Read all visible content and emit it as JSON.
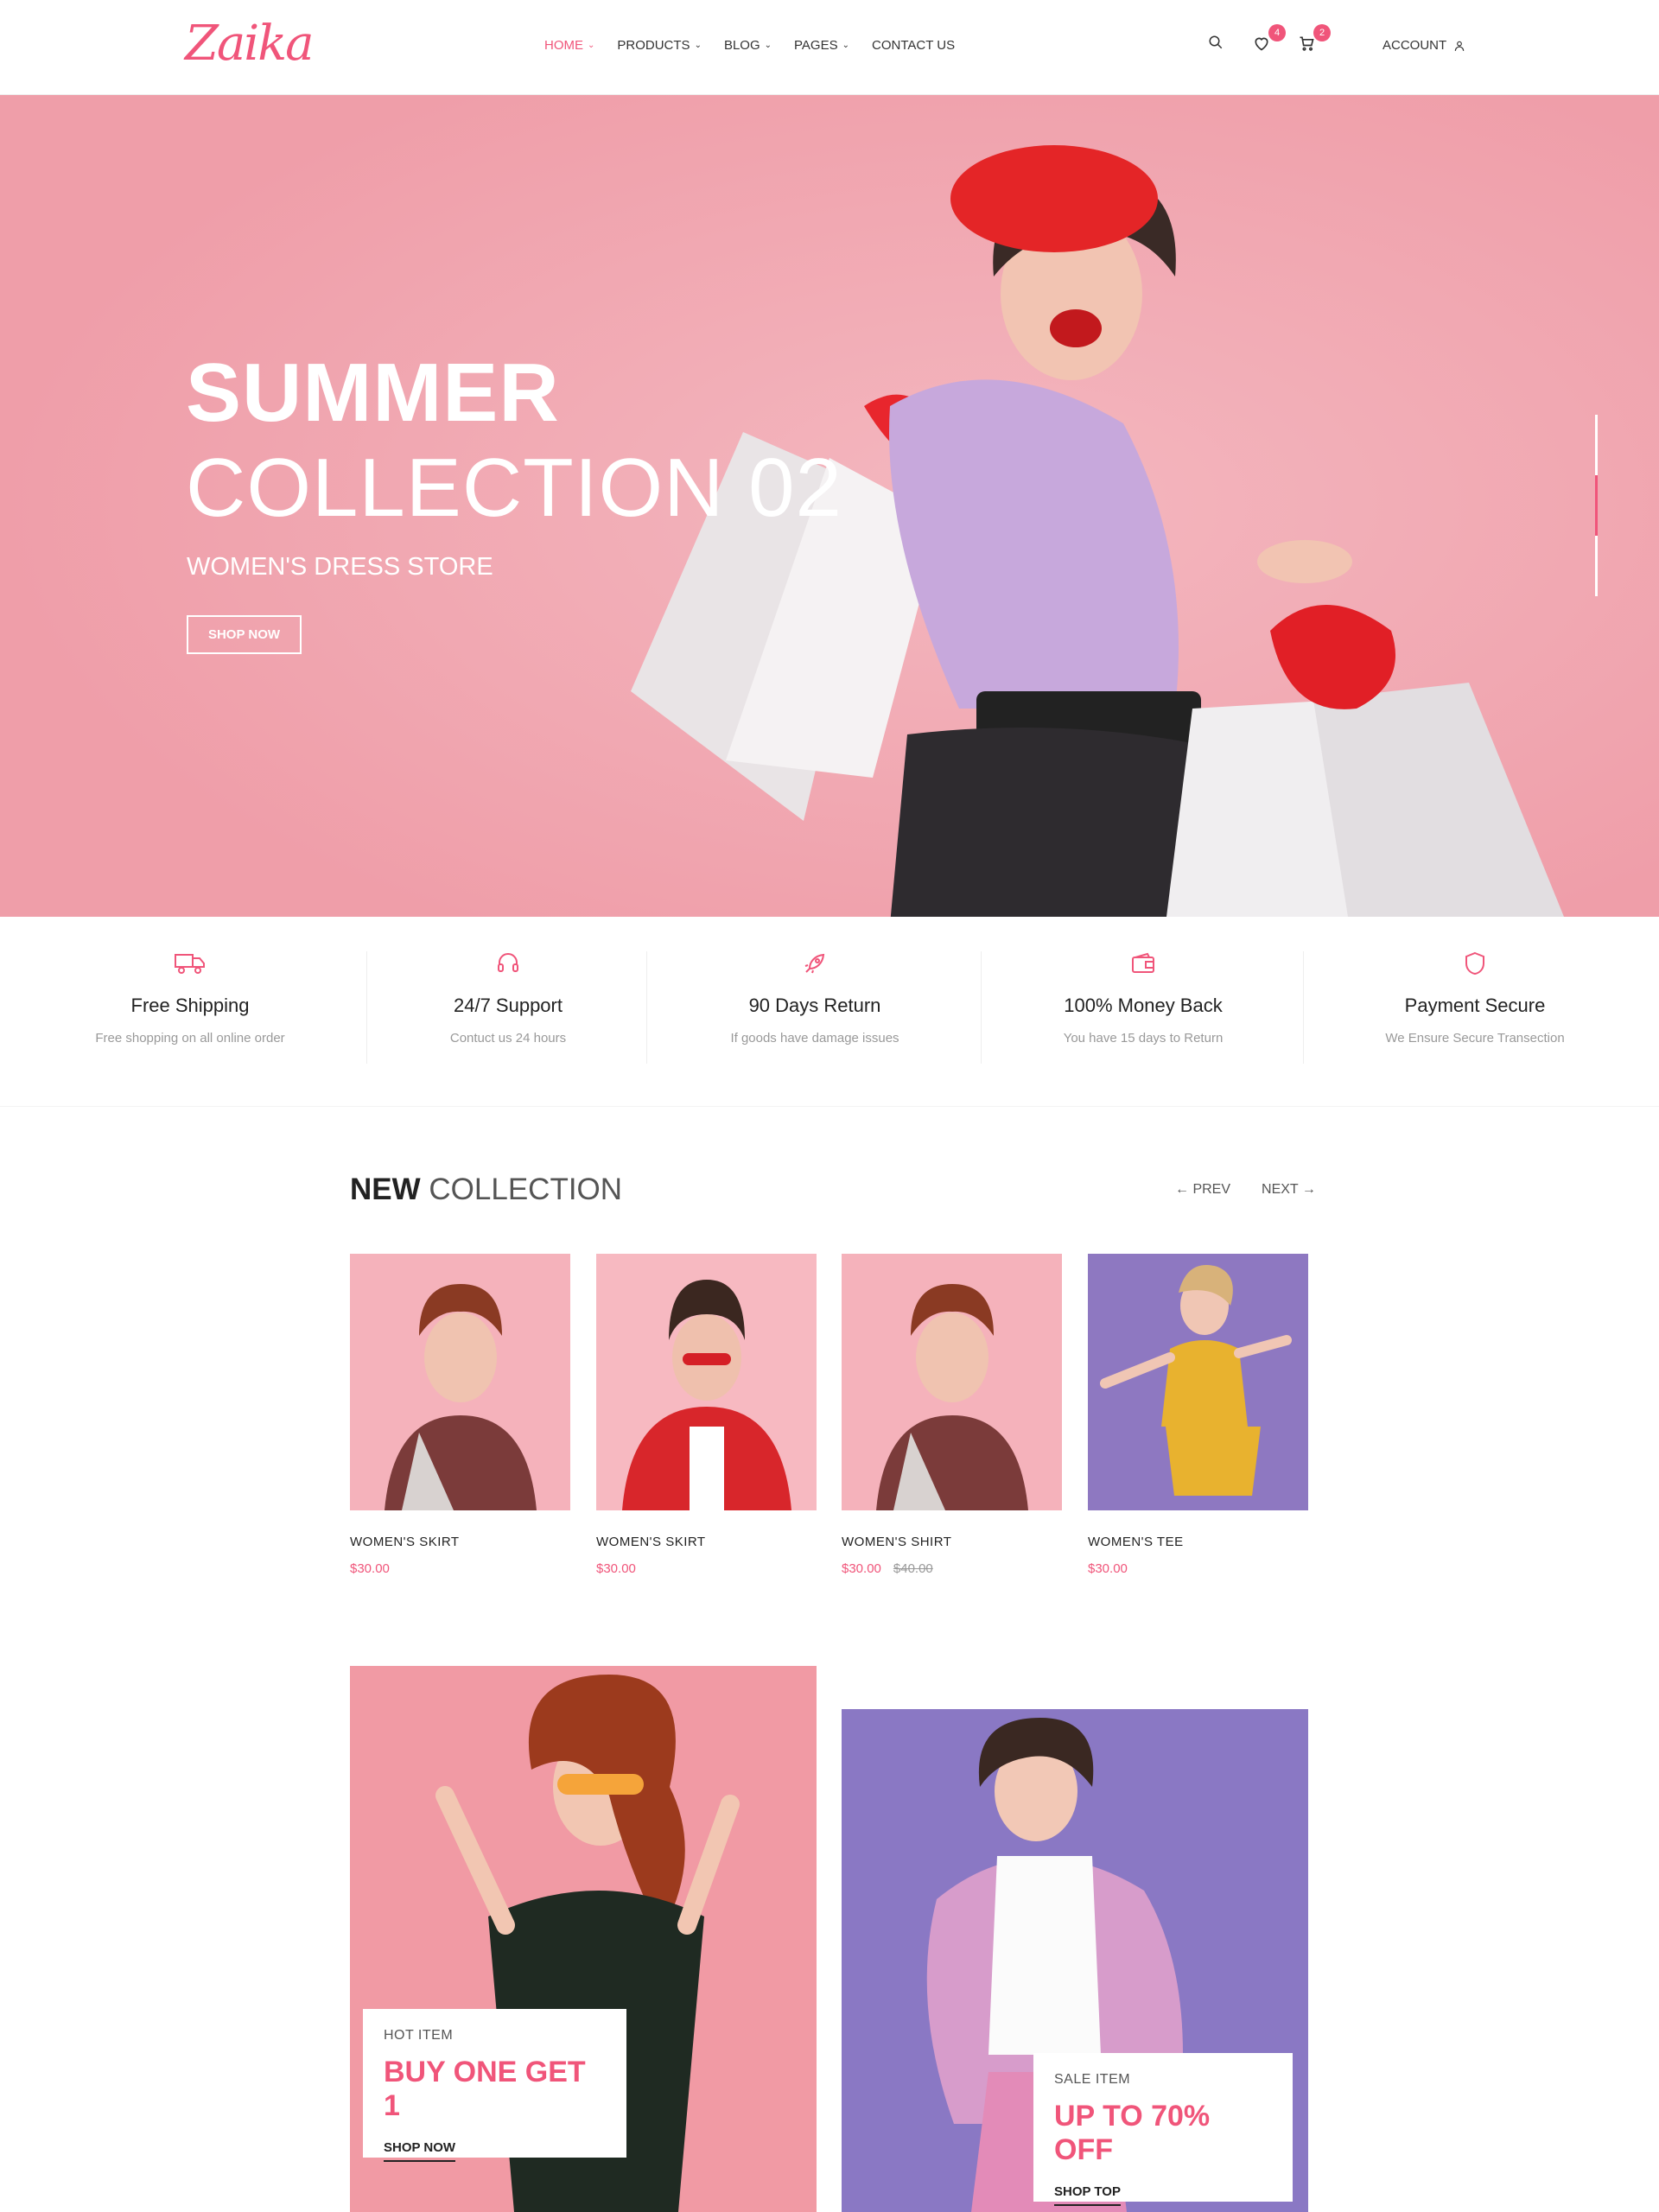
{
  "brand": {
    "logo": "Zaika"
  },
  "nav": {
    "items": [
      {
        "label": "HOME",
        "active": true,
        "has_dropdown": true
      },
      {
        "label": "PRODUCTS",
        "active": false,
        "has_dropdown": true
      },
      {
        "label": "BLOG",
        "active": false,
        "has_dropdown": true
      },
      {
        "label": "PAGES",
        "active": false,
        "has_dropdown": true
      },
      {
        "label": "CONTACT US",
        "active": false,
        "has_dropdown": false
      }
    ],
    "wishlist_count": "4",
    "cart_count": "2",
    "account_label": "ACCOUNT"
  },
  "hero": {
    "title_line1": "SUMMER",
    "title_line2": "COLLECTION 02",
    "subtitle": "WOMEN'S DRESS STORE",
    "cta": "SHOP NOW"
  },
  "features": [
    {
      "icon": "truck-icon",
      "title": "Free Shipping",
      "desc": "Free shopping on all online order"
    },
    {
      "icon": "headset-icon",
      "title": "24/7 Support",
      "desc": "Contuct us 24 hours"
    },
    {
      "icon": "rocket-icon",
      "title": "90 Days Return",
      "desc": "If goods have damage issues"
    },
    {
      "icon": "wallet-icon",
      "title": "100% Money Back",
      "desc": "You have 15 days to Return"
    },
    {
      "icon": "shield-icon",
      "title": "Payment Secure",
      "desc": "We Ensure Secure Transection"
    }
  ],
  "collection": {
    "title_bold": "NEW",
    "title_rest": "COLLECTION",
    "prev": "← PREV",
    "next": "NEXT →",
    "products": [
      {
        "name": "WOMEN'S SKIRT",
        "price": "$30.00",
        "old_price": ""
      },
      {
        "name": "WOMEN'S SKIRT",
        "price": "$30.00",
        "old_price": ""
      },
      {
        "name": "WOMEN'S SHIRT",
        "price": "$30.00",
        "old_price": "$40.00"
      },
      {
        "name": "WOMEN'S TEE",
        "price": "$30.00",
        "old_price": ""
      }
    ]
  },
  "promos": [
    {
      "tag": "HOT ITEM",
      "headline": "BUY ONE GET 1",
      "link": "SHOP NOW"
    },
    {
      "tag": "SALE ITEM",
      "headline": "UP TO 70% OFF",
      "link": "SHOP TOP"
    }
  ],
  "colors": {
    "accent": "#f0557a",
    "hero_bg": "#f2acb5",
    "promo_purple": "#8a78c4"
  }
}
